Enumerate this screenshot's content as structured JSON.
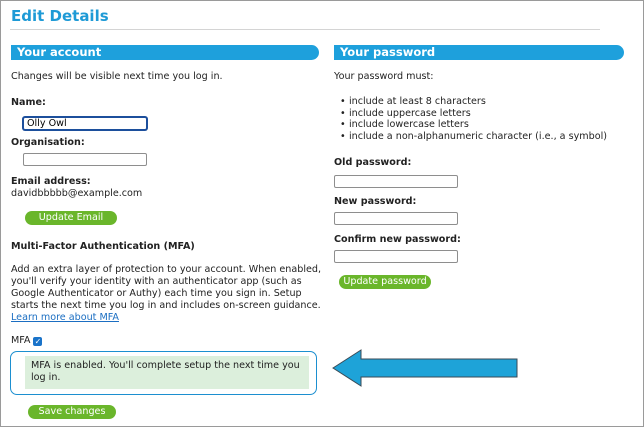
{
  "page": {
    "title": "Edit Details"
  },
  "account": {
    "header": "Your account",
    "intro": "Changes will be visible next time you log in.",
    "name_label": "Name:",
    "name_value": "Olly Owl",
    "organisation_label": "Organisation:",
    "organisation_value": "",
    "email_label": "Email address:",
    "email_value": "davidbbbbb@example.com",
    "update_email_button": "Update Email",
    "mfa_heading": "Multi-Factor Authentication (MFA)",
    "mfa_description_lines": [
      "Add an extra layer of protection to your account. When enabled,",
      "you'll verify your identity with an authenticator app (such as",
      "Google Authenticator or Authy) each time you sign in. Setup",
      "starts the next time you log in and includes on-screen guidance."
    ],
    "mfa_learn_more": "Learn more about MFA",
    "mfa_checkbox_label": "MFA",
    "mfa_checked": true,
    "mfa_notice_lines": [
      "MFA is enabled. You'll complete setup the next time you",
      "log in."
    ],
    "save_button": "Save changes"
  },
  "password": {
    "header": "Your password",
    "intro": "Your password must:",
    "rules": [
      "include at least 8 characters",
      "include uppercase letters",
      "include lowercase letters",
      "include a non-alphanumeric character (i.e., a symbol)"
    ],
    "old_label": "Old password:",
    "new_label": "New password:",
    "confirm_label": "Confirm new password:",
    "update_button": "Update password"
  },
  "colors": {
    "accent": "#1ea0dc",
    "button": "#6ab62b",
    "notice_bg": "#dcefdc",
    "arrow": "#1ea3d8"
  }
}
